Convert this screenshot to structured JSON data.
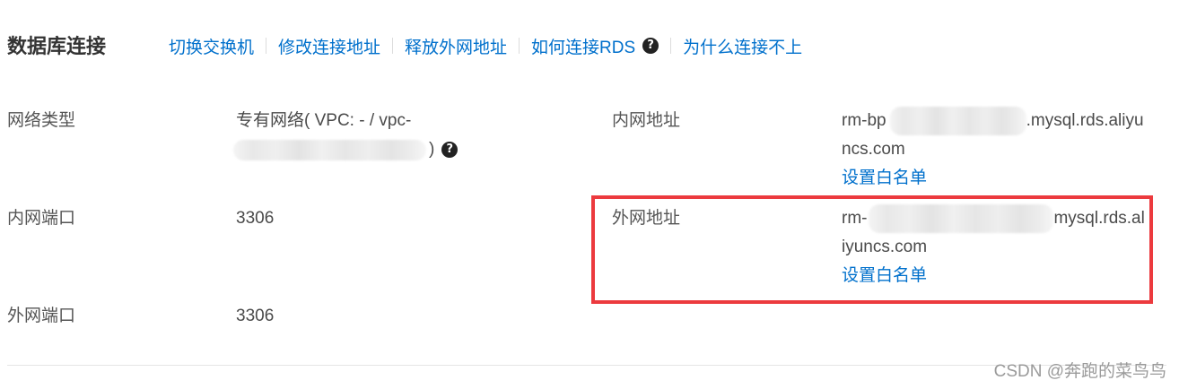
{
  "colors": {
    "link": "#0070cc",
    "title": "#333333",
    "label": "#555555",
    "value": "#4a4a4a",
    "highlight_border": "#ec3a3e",
    "help_icon_bg": "#222222",
    "divider": "#e5e5e5",
    "watermark": "#9a9a9a"
  },
  "header": {
    "title": "数据库连接",
    "actions": [
      {
        "label": "切换交换机"
      },
      {
        "label": "修改连接地址"
      },
      {
        "label": "释放外网地址"
      },
      {
        "label": "如何连接RDS",
        "icon": "question-circle-icon"
      },
      {
        "label": "为什么连接不上"
      }
    ]
  },
  "fields": {
    "network_type": {
      "label": "网络类型",
      "value_line1": "专有网络( VPC: - / vpc-",
      "value_line2_end": ")",
      "icon": "question-circle-icon"
    },
    "internal_address": {
      "label": "内网地址",
      "prefix": "rm-bp",
      "suffix": ".mysql.rds.aliyu",
      "line2": "ncs.com",
      "whitelist_link": "设置白名单"
    },
    "internal_port": {
      "label": "内网端口",
      "value": "3306"
    },
    "public_address": {
      "label": "外网地址",
      "prefix": "rm-",
      "suffix": "mysql.rds.al",
      "line2": "iyuncs.com",
      "whitelist_link": "设置白名单"
    },
    "public_port": {
      "label": "外网端口",
      "value": "3306"
    }
  },
  "watermark": "CSDN @奔跑的菜鸟鸟"
}
